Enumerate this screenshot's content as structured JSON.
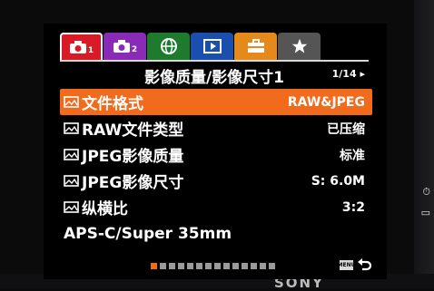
{
  "tabs": [
    {
      "icon": "camera1-icon",
      "label": "1",
      "color": "#d81b27",
      "active": true
    },
    {
      "icon": "camera2-icon",
      "label": "2",
      "color": "#8a2bb8"
    },
    {
      "icon": "globe-icon",
      "label": "",
      "color": "#1e7b2e"
    },
    {
      "icon": "playback-icon",
      "label": "",
      "color": "#1a4fb0"
    },
    {
      "icon": "toolbox-icon",
      "label": "",
      "color": "#e58a1a"
    },
    {
      "icon": "star-icon",
      "label": "",
      "color": "#555555"
    }
  ],
  "header": {
    "title": "影像质量/影像尺寸1",
    "page_indicator": "1/14"
  },
  "menu": {
    "items": [
      {
        "label": "文件格式",
        "value": "RAW&JPEG",
        "selected": true,
        "icon": "image-icon"
      },
      {
        "label": "RAW文件类型",
        "value": "已压缩",
        "icon": "image-icon"
      },
      {
        "label": "JPEG影像质量",
        "value": "标准",
        "icon": "image-icon"
      },
      {
        "label": "JPEG影像尺寸",
        "value": "S: 6.0M",
        "icon": "image-icon"
      },
      {
        "label": "纵横比",
        "value": "3:2",
        "icon": "image-icon"
      },
      {
        "label": "APS-C/Super 35mm",
        "value": ""
      }
    ]
  },
  "pager": {
    "total": 14,
    "current": 1
  },
  "footer": {
    "menu_label": "MENU",
    "back_icon": "back-arrow-icon"
  },
  "brand": "SONY",
  "colors": {
    "accent": "#f26a1b",
    "background": "#000000",
    "text": "#ffffff"
  }
}
